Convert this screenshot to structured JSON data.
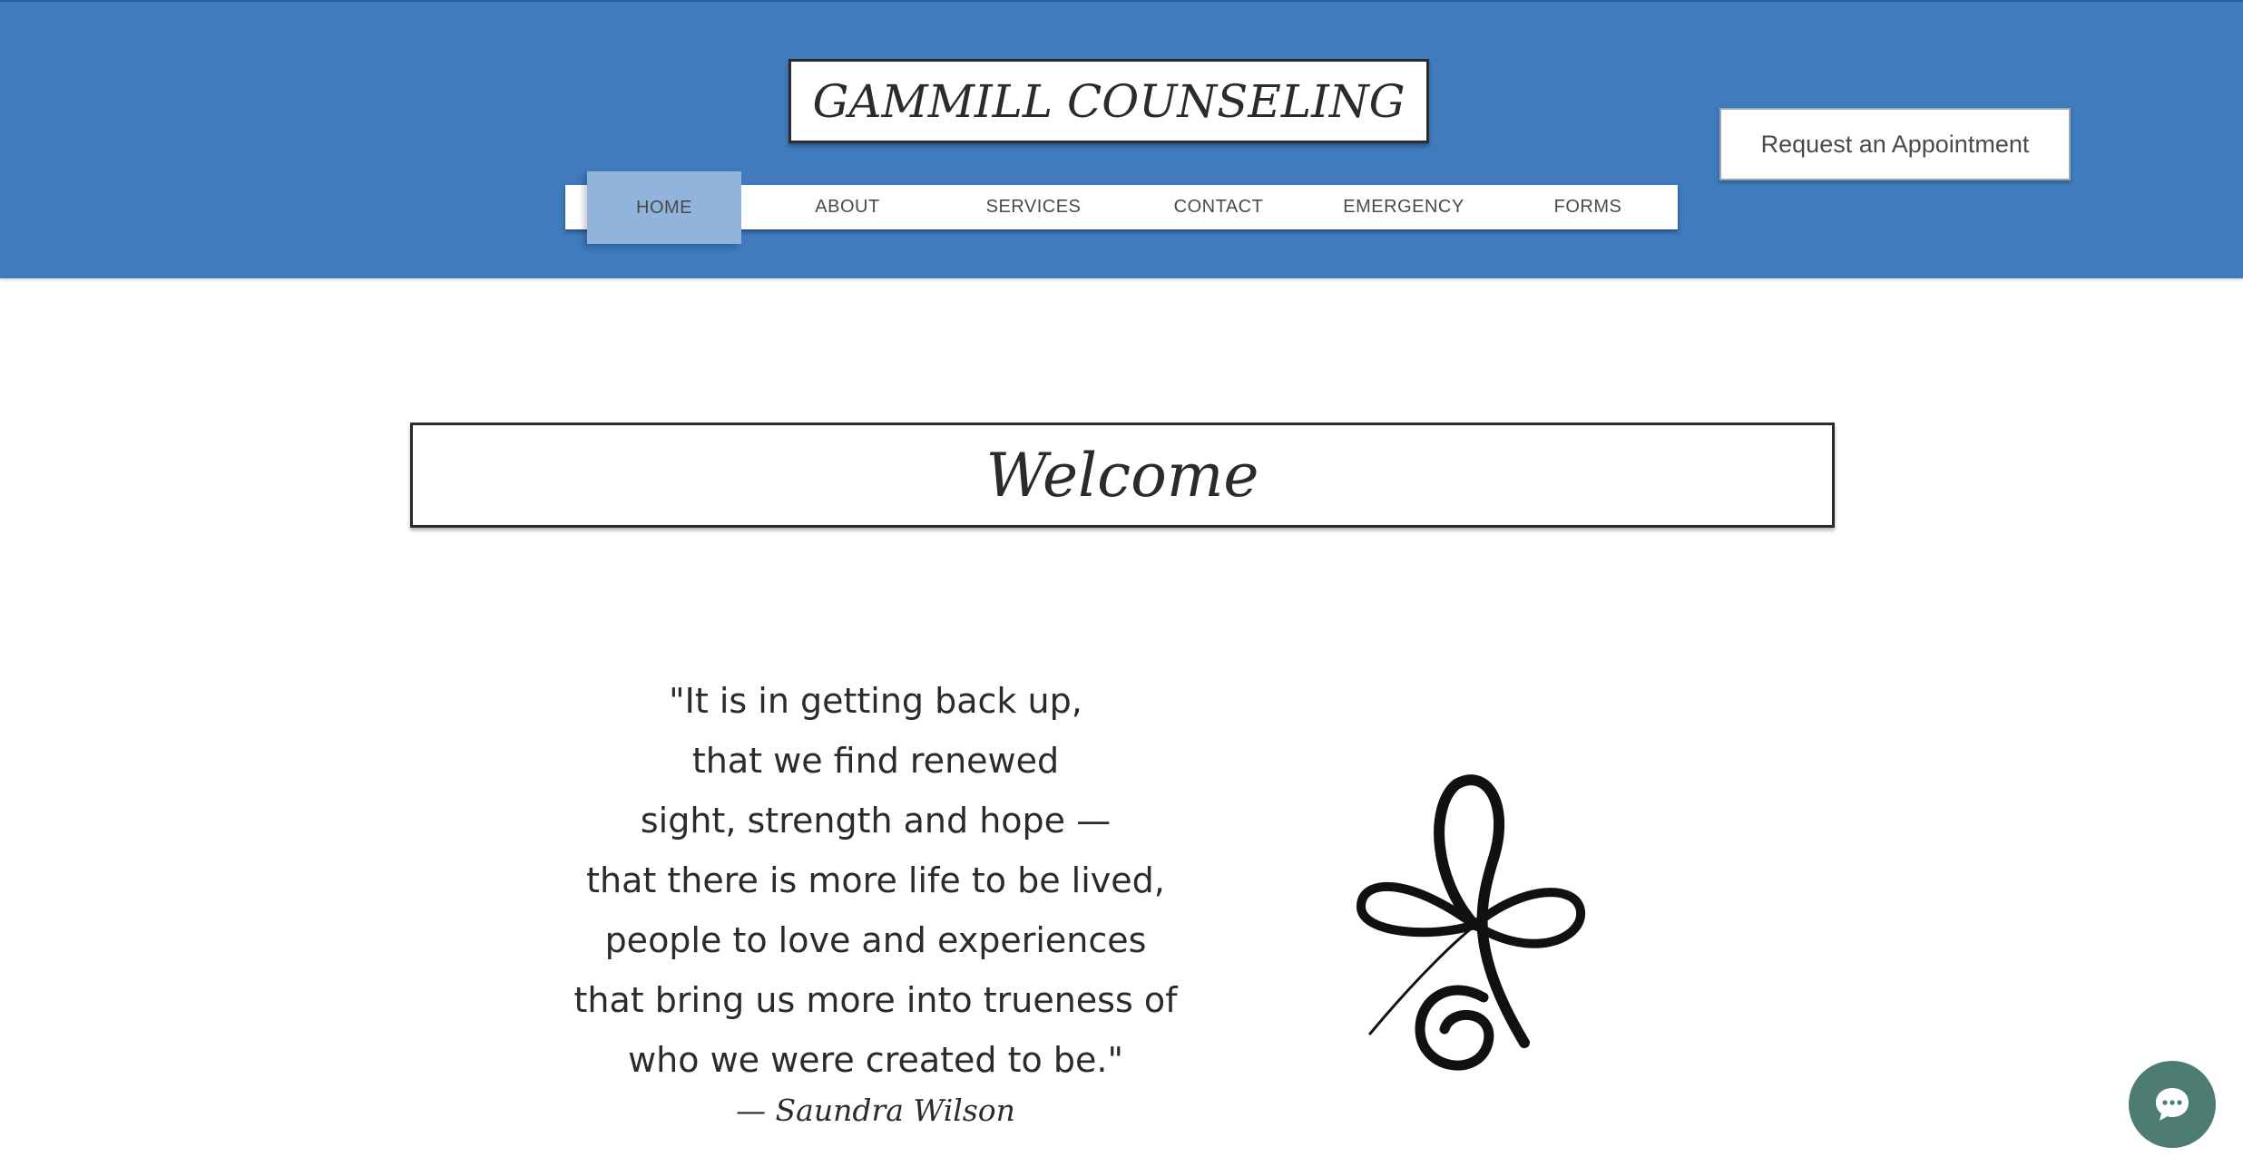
{
  "header": {
    "logo_text": "GAMMILL COUNSELING",
    "appointment_button": "Request an Appointment",
    "background_color": "#3f7bbd"
  },
  "nav": {
    "items": [
      {
        "label": "HOME",
        "active": true
      },
      {
        "label": "ABOUT",
        "active": false
      },
      {
        "label": "SERVICES",
        "active": false
      },
      {
        "label": "CONTACT",
        "active": false
      },
      {
        "label": "EMERGENCY",
        "active": false
      },
      {
        "label": "FORMS",
        "active": false
      }
    ],
    "active_color": "#92b4dc"
  },
  "main": {
    "welcome_title": "Welcome",
    "quote_lines": [
      "\"It is in getting back up,",
      "that we find renewed",
      "sight, strength and hope —",
      "that there is more life to be lived,",
      "people to love and experiences",
      "that bring us more into trueness of",
      "who we were created to be.\""
    ],
    "attribution": "— Saundra Wilson",
    "symbol_icon": "unalome-symbol-icon"
  },
  "chat": {
    "icon": "chat-bubble-icon",
    "color": "#4c7c72"
  }
}
